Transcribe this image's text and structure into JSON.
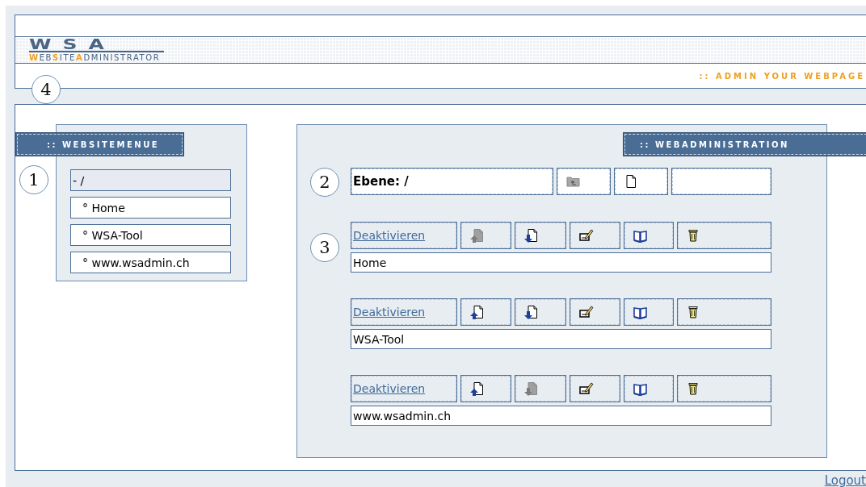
{
  "header": {
    "logo_title": "WSA",
    "logo_subtitle": [
      {
        "text": "W",
        "accent": true
      },
      {
        "text": "EB",
        "accent": false
      },
      {
        "text": "S",
        "accent": true
      },
      {
        "text": "ITE",
        "accent": false
      },
      {
        "text": "A",
        "accent": true
      },
      {
        "text": "DMINISTRATOR",
        "accent": false
      }
    ],
    "tagline": ":: ADMIN YOUR WEBPAGE",
    "marker": "4"
  },
  "website_menu": {
    "heading": ":: WEBSITEMENUE",
    "marker": "1",
    "items": [
      {
        "label": "- /",
        "selected": true
      },
      {
        "label": "° Home",
        "selected": false
      },
      {
        "label": "° WSA-Tool",
        "selected": false
      },
      {
        "label": "° www.wsadmin.ch",
        "selected": false
      }
    ]
  },
  "web_administration": {
    "heading": ":: WEBADMINISTRATION",
    "level": {
      "marker": "2",
      "label": "Ebene: /",
      "folder_up_disabled": true
    },
    "entries_marker": "3",
    "entries": [
      {
        "action_link": "Deaktivieren",
        "move_up_disabled": true,
        "move_down_disabled": false,
        "name": "Home"
      },
      {
        "action_link": "Deaktivieren",
        "move_up_disabled": false,
        "move_down_disabled": false,
        "name": "WSA-Tool"
      },
      {
        "action_link": "Deaktivieren",
        "move_up_disabled": false,
        "move_down_disabled": true,
        "name": "www.wsadmin.ch"
      }
    ]
  },
  "logout_link": "Logout"
}
